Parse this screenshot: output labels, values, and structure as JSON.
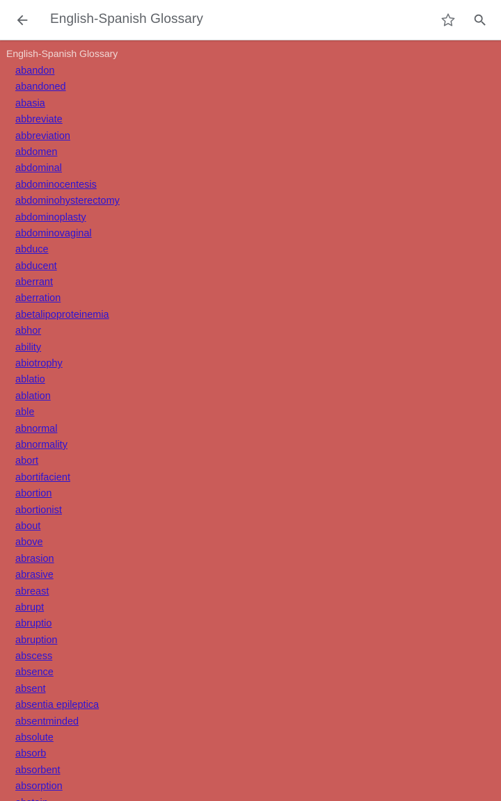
{
  "appbar": {
    "title": "English-Spanish Glossary",
    "back_icon": "arrow-back-icon",
    "favorite_icon": "star-outline-icon",
    "search_icon": "search-icon"
  },
  "content": {
    "heading": "English-Spanish Glossary",
    "terms": [
      "abandon",
      "abandoned",
      "abasia",
      "abbreviate",
      "abbreviation",
      "abdomen",
      "abdominal",
      "abdominocentesis",
      "abdominohysterectomy",
      "abdominoplasty",
      "abdominovaginal",
      "abduce",
      "abducent",
      "aberrant",
      "aberration",
      "abetalipoproteinemia",
      "abhor",
      "ability",
      "abiotrophy",
      "ablatio",
      "ablation",
      "able",
      "abnormal",
      "abnormality",
      "abort",
      "abortifacient",
      "abortion",
      "abortionist",
      "about",
      "above",
      "abrasion",
      "abrasive",
      "abreast",
      "abrupt",
      "abruptio",
      "abruption",
      "abscess",
      "absence",
      "absent",
      "absentia epileptica",
      "absentminded",
      "absolute",
      "absorb",
      "absorbent",
      "absorption",
      "abstain"
    ]
  },
  "colors": {
    "background": "#ca5c59",
    "link": "#2a14d6",
    "heading": "#f0d6d4",
    "appbar": "#ffffff"
  }
}
